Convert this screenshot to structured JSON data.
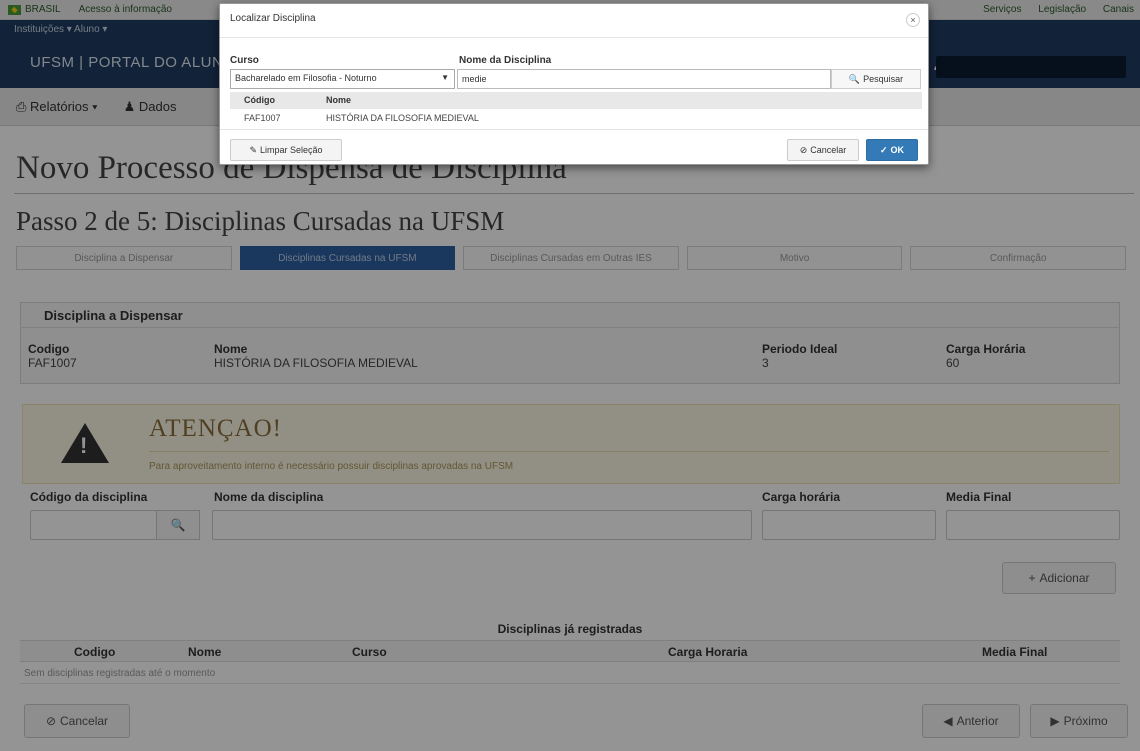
{
  "govbar": {
    "country": "BRASIL",
    "access": "Acesso à informação",
    "links": [
      "Serviços",
      "Legislação",
      "Canais"
    ]
  },
  "appbar": {
    "roles": "Instituições ▾  Aluno ▾",
    "brand": "UFSM | PORTAL DO ALUNO"
  },
  "menubar": {
    "relatorios": "Relatórios ▾",
    "dados": "Dados"
  },
  "page": {
    "title": "Novo Processo de Dispensa de Disciplina",
    "step": "Passo 2 de 5: Disciplinas Cursadas na UFSM",
    "steps": [
      "Disciplina a Dispensar",
      "Disciplinas Cursadas na UFSM",
      "Disciplinas Cursadas em Outras IES",
      "Motivo",
      "Confirmação"
    ]
  },
  "dispensar": {
    "heading": "Disciplina a Dispensar",
    "codigo_label": "Codigo",
    "codigo": "FAF1007",
    "nome_label": "Nome",
    "nome": "HISTÓRIA DA FILOSOFIA MEDIEVAL",
    "periodo_label": "Periodo Ideal",
    "periodo": "3",
    "carga_label": "Carga Horária",
    "carga": "60"
  },
  "alert": {
    "title": "ATENÇAO!",
    "message": "Para aproveitamento interno é necessário possuir disciplinas aprovadas na UFSM"
  },
  "form": {
    "codigo_label": "Código da disciplina",
    "nome_label": "Nome da disciplina",
    "carga_label": "Carga horária",
    "media_label": "Media Final",
    "add_button": "Adicionar"
  },
  "registradas": {
    "title": "Disciplinas já registradas",
    "columns": [
      "Codigo",
      "Nome",
      "Curso",
      "Carga Horaria",
      "Media Final"
    ],
    "empty": "Sem disciplinas registradas até o momento"
  },
  "bottom": {
    "cancel": "Cancelar",
    "prev": "Anterior",
    "next": "Próximo"
  },
  "modal": {
    "title": "Localizar Disciplina",
    "curso_label": "Curso",
    "curso_value": "Bacharelado em Filosofia - Noturno",
    "nome_label": "Nome da Disciplina",
    "nome_value": "medie",
    "search_button": "Pesquisar",
    "columns": [
      "Código",
      "Nome"
    ],
    "rows": [
      {
        "codigo": "FAF1007",
        "nome": "HISTÓRIA DA FILOSOFIA MEDIEVAL"
      }
    ],
    "clear_button": "Limpar Seleção",
    "cancel_button": "Cancelar",
    "ok_button": "OK"
  }
}
